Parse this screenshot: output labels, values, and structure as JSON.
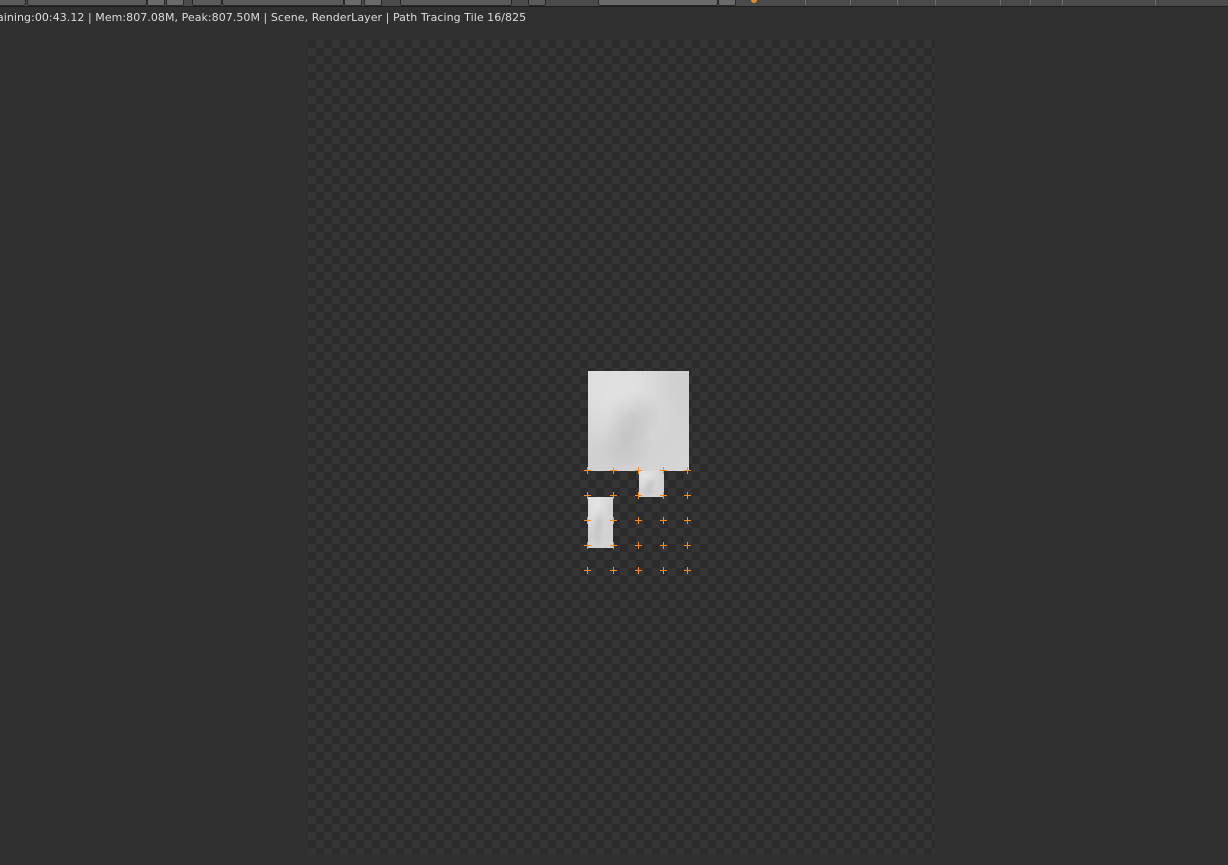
{
  "render_info": {
    "text": "aining:00:43.12 | Mem:807.08M, Peak:807.50M | Scene, RenderLayer | Path Tracing Tile 16/825"
  },
  "colors": {
    "background": "#303030",
    "canvas_checker_dark": "#2b2b2b",
    "canvas_checker_light": "#343434",
    "tile_marker": "#ff8c1a",
    "rendered_tile": "#d8d8d8"
  },
  "icons": {
    "tile_marker": "crosshair",
    "header_dot": "record-dot"
  },
  "render_progress": {
    "tiles_done": 16,
    "tiles_total": 825
  }
}
